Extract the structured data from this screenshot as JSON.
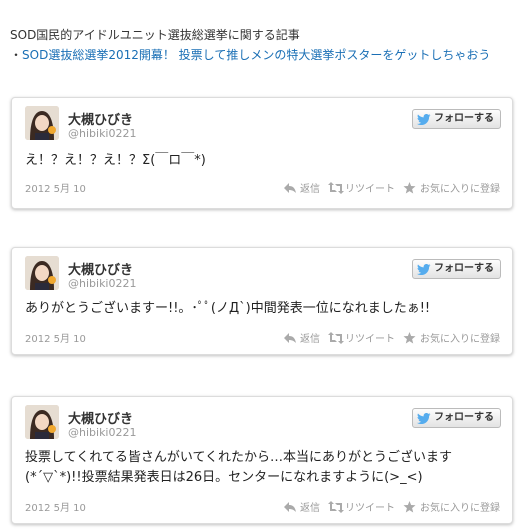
{
  "header": {
    "title": "SOD国民的アイドルユニット選抜総選挙に関する記事",
    "bullet": "・",
    "link_text": "SOD選抜総選挙2012開幕！ 投票して推しメンの特大選挙ポスターをゲットしちゃおう"
  },
  "tweets": [
    {
      "name": "大槻ひびき",
      "handle": "@hibiki0221",
      "follow_label": "フォローする",
      "text_lines": [
        "え！？え！？え！？Σ(￣ロ￣*)"
      ],
      "date": "2012 5月 10",
      "reply_label": "返信",
      "retweet_label": "リツイート",
      "favorite_label": "お気に入りに登録"
    },
    {
      "name": "大槻ひびき",
      "handle": "@hibiki0221",
      "follow_label": "フォローする",
      "text_lines": [
        "ありがとうございますー!!。･ﾟﾟ(ノД`)中間発表一位になれましたぁ!!"
      ],
      "date": "2012 5月 10",
      "reply_label": "返信",
      "retweet_label": "リツイート",
      "favorite_label": "お気に入りに登録"
    },
    {
      "name": "大槻ひびき",
      "handle": "@hibiki0221",
      "follow_label": "フォローする",
      "text_lines": [
        "投票してくれてる皆さんがいてくれたから…本当にありがとうございます",
        "(*´▽`*)!!投票結果発表日は26日。センターになれますように(>_<)"
      ],
      "date": "2012 5月 10",
      "reply_label": "返信",
      "retweet_label": "リツイート",
      "favorite_label": "お気に入りに登録"
    }
  ],
  "colors": {
    "link": "#1a6fb5",
    "twitter_blue": "#55acee",
    "meta_gray": "#999999"
  },
  "icons": {
    "follow": "twitter-bird-icon",
    "reply": "reply-arrow-icon",
    "retweet": "retweet-icon",
    "favorite": "star-icon"
  }
}
